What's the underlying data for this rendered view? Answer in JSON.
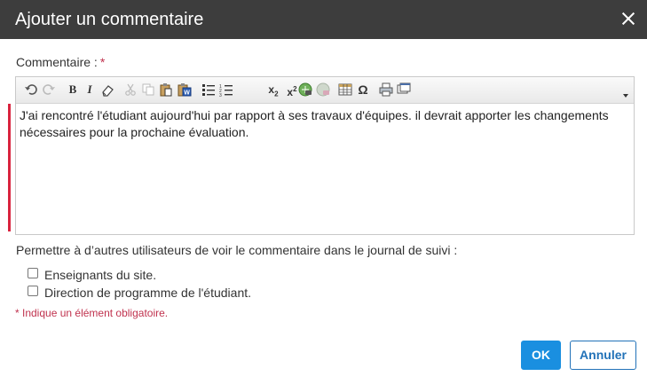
{
  "dialog": {
    "title": "Ajouter un commentaire",
    "close_glyph": "×"
  },
  "form": {
    "comment_label": "Commentaire :",
    "required_mark": "*",
    "comment_text": "J'ai rencontré l'étudiant aujourd'hui par rapport à ses travaux d'équipes. il devrait apporter les changements nécessaires pour la prochaine évaluation.",
    "visibility_label": "Permettre à d’autres utilisateurs de voir le commentaire dans le journal de suivi :",
    "options": [
      {
        "label": "Enseignants du site.",
        "checked": false
      },
      {
        "label": "Direction de programme de l'étudiant.",
        "checked": false
      }
    ],
    "required_note": "* Indique un élément obligatoire."
  },
  "toolbar": {
    "items": [
      {
        "name": "undo-icon",
        "glyph": "↶"
      },
      {
        "name": "redo-icon",
        "glyph": "↷"
      },
      {
        "name": "bold-icon",
        "glyph": "B"
      },
      {
        "name": "italic-icon",
        "glyph": "I"
      },
      {
        "name": "eraser-icon",
        "glyph": "⌫"
      },
      {
        "name": "cut-icon",
        "glyph": "✂"
      },
      {
        "name": "copy-icon",
        "glyph": "⎘"
      },
      {
        "name": "paste-icon",
        "glyph": "📋"
      },
      {
        "name": "paste-word-icon",
        "glyph": "W"
      },
      {
        "name": "bullet-list-icon",
        "glyph": "☰"
      },
      {
        "name": "numbered-list-icon",
        "glyph": "☷"
      },
      {
        "name": "subscript-icon",
        "glyph": "x₂"
      },
      {
        "name": "superscript-icon",
        "glyph": "x²"
      },
      {
        "name": "link-icon",
        "glyph": "🔗"
      },
      {
        "name": "unlink-icon",
        "glyph": "⛓"
      },
      {
        "name": "table-icon",
        "glyph": "▦"
      },
      {
        "name": "special-char-icon",
        "glyph": "Ω"
      },
      {
        "name": "print-icon",
        "glyph": "⎙"
      },
      {
        "name": "preview-icon",
        "glyph": "▭"
      }
    ]
  },
  "buttons": {
    "ok": "OK",
    "cancel": "Annuler"
  },
  "colors": {
    "header_bg": "#3d3d3d",
    "accent": "#1a8fe0",
    "required": "#c0324e",
    "validation_bar": "#d9233e"
  }
}
